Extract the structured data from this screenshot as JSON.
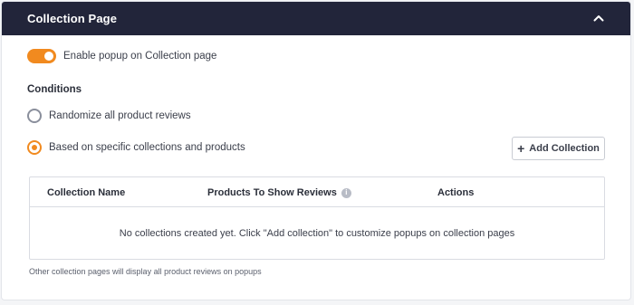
{
  "panel": {
    "title": "Collection Page",
    "collapse_icon": "chevron-up-icon"
  },
  "toggle": {
    "label": "Enable popup on Collection page",
    "enabled": true,
    "accent_color": "#f18a1f"
  },
  "conditions": {
    "heading": "Conditions",
    "options": [
      {
        "label": "Randomize all product reviews",
        "selected": false
      },
      {
        "label": "Based on specific collections and products",
        "selected": true
      }
    ]
  },
  "add_collection": {
    "label": "Add Collection",
    "icon": "plus-icon"
  },
  "table": {
    "columns": [
      "Collection Name",
      "Products To Show Reviews",
      "Actions"
    ],
    "info_icon": "info-icon",
    "empty_message": "No collections created yet. Click \"Add collection\" to customize popups on collection pages"
  },
  "footnote": "Other collection pages will display all product reviews on popups"
}
